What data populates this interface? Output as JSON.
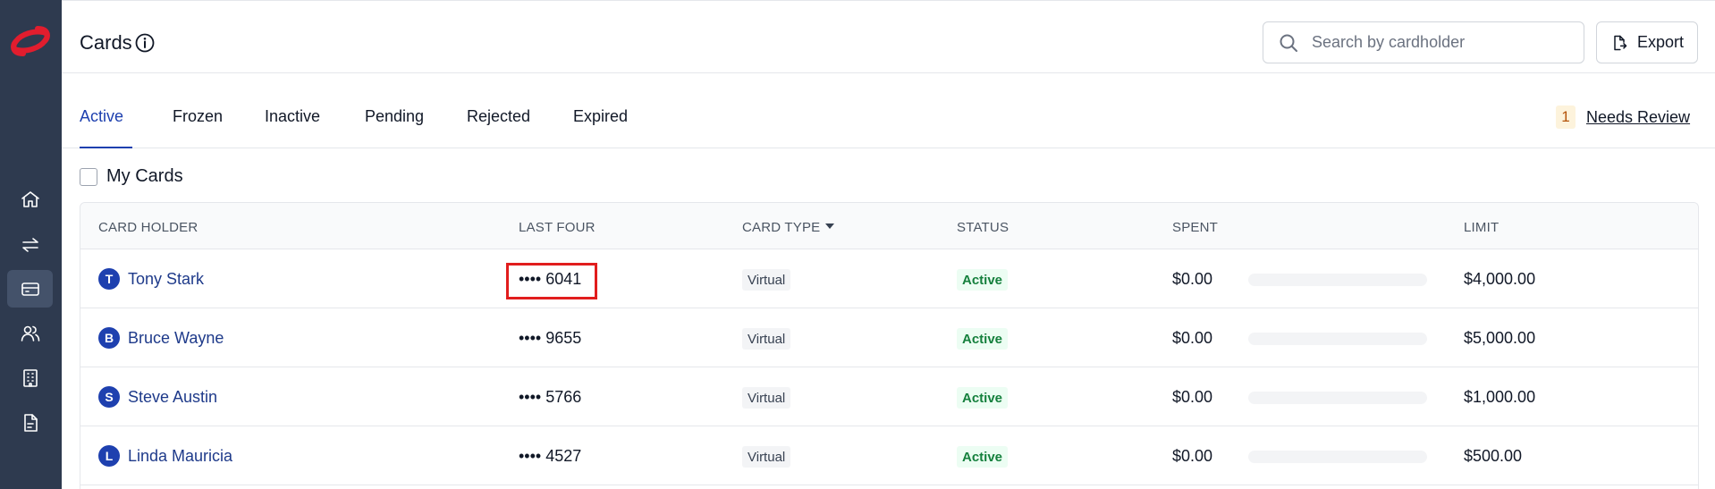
{
  "header": {
    "title": "Cards",
    "search_placeholder": "Search by cardholder",
    "export_label": "Export"
  },
  "tabs": [
    {
      "label": "Active"
    },
    {
      "label": "Frozen"
    },
    {
      "label": "Inactive"
    },
    {
      "label": "Pending"
    },
    {
      "label": "Rejected"
    },
    {
      "label": "Expired"
    }
  ],
  "review": {
    "count": "1",
    "label": "Needs Review"
  },
  "filter": {
    "my_cards_label": "My Cards"
  },
  "table": {
    "columns": [
      "CARD HOLDER",
      "LAST FOUR",
      "CARD TYPE",
      "STATUS",
      "SPENT",
      "LIMIT"
    ],
    "rows": [
      {
        "initial": "T",
        "name": "Tony Stark",
        "last_four": "•••• 6041",
        "type": "Virtual",
        "status": "Active",
        "spent": "$0.00",
        "spent_fraction": 0,
        "limit": "$4,000.00"
      },
      {
        "initial": "B",
        "name": "Bruce Wayne",
        "last_four": "•••• 9655",
        "type": "Virtual",
        "status": "Active",
        "spent": "$0.00",
        "spent_fraction": 0,
        "limit": "$5,000.00"
      },
      {
        "initial": "S",
        "name": "Steve Austin",
        "last_four": "•••• 5766",
        "type": "Virtual",
        "status": "Active",
        "spent": "$0.00",
        "spent_fraction": 0,
        "limit": "$1,000.00"
      },
      {
        "initial": "L",
        "name": "Linda Mauricia",
        "last_four": "•••• 4527",
        "type": "Virtual",
        "status": "Active",
        "spent": "$0.00",
        "spent_fraction": 0,
        "limit": "$500.00"
      }
    ]
  },
  "colors": {
    "sidebar": "#2e3a4f",
    "accent": "#1e40af",
    "logo": "#e11d2e",
    "highlight": "#e11d1d",
    "active_status": "#15803d"
  }
}
